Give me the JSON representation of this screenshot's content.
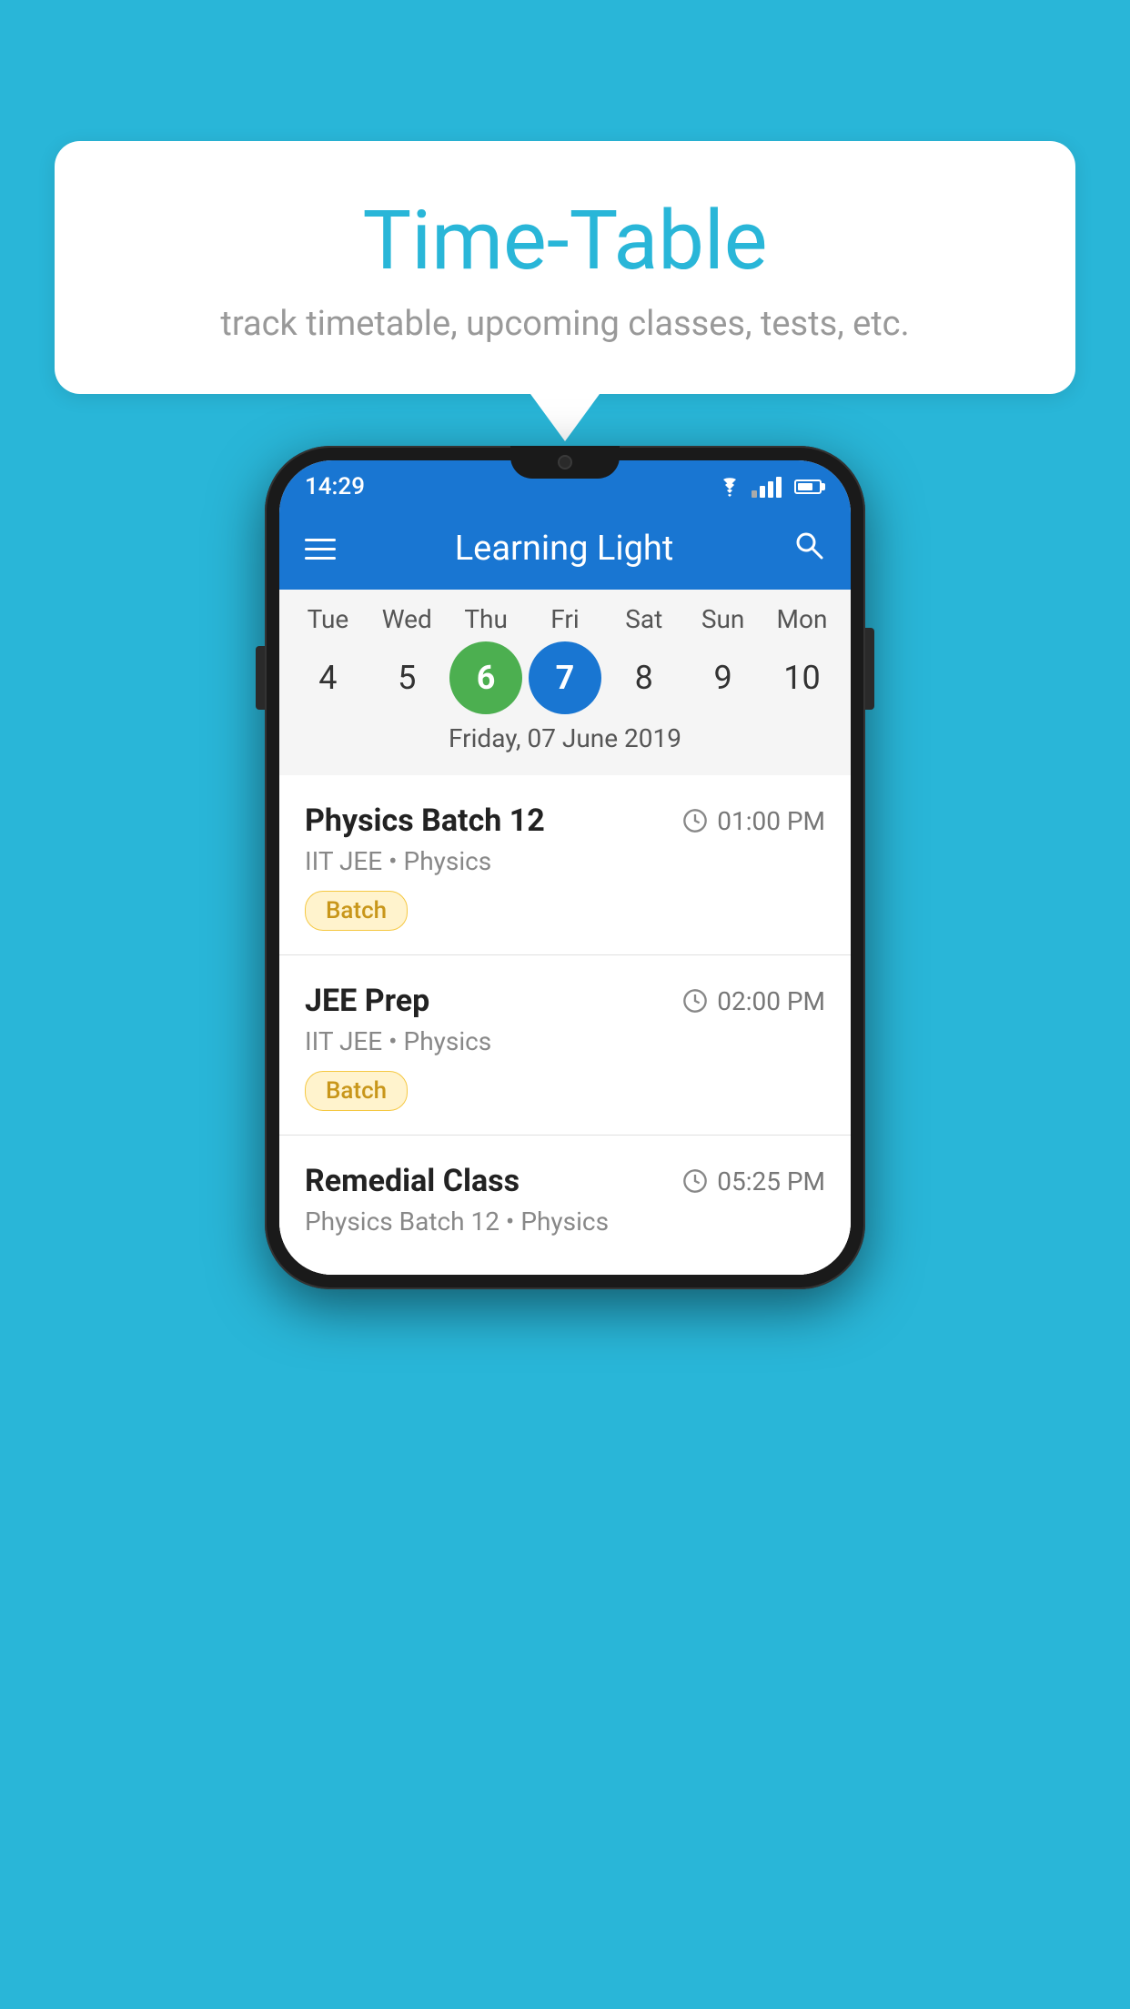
{
  "background": {
    "color": "#29b6d8"
  },
  "speech_bubble": {
    "title": "Time-Table",
    "subtitle": "track timetable, upcoming classes, tests, etc."
  },
  "phone": {
    "status_bar": {
      "time": "14:29"
    },
    "app_bar": {
      "title": "Learning Light"
    },
    "calendar": {
      "days": [
        {
          "label": "Tue",
          "num": "4"
        },
        {
          "label": "Wed",
          "num": "5"
        },
        {
          "label": "Thu",
          "num": "6",
          "state": "today"
        },
        {
          "label": "Fri",
          "num": "7",
          "state": "selected"
        },
        {
          "label": "Sat",
          "num": "8"
        },
        {
          "label": "Sun",
          "num": "9"
        },
        {
          "label": "Mon",
          "num": "10"
        }
      ],
      "selected_date_label": "Friday, 07 June 2019"
    },
    "schedule_items": [
      {
        "title": "Physics Batch 12",
        "time": "01:00 PM",
        "subtitle": "IIT JEE • Physics",
        "badge": "Batch"
      },
      {
        "title": "JEE Prep",
        "time": "02:00 PM",
        "subtitle": "IIT JEE • Physics",
        "badge": "Batch"
      },
      {
        "title": "Remedial Class",
        "time": "05:25 PM",
        "subtitle": "Physics Batch 12 • Physics",
        "badge": null
      }
    ]
  }
}
